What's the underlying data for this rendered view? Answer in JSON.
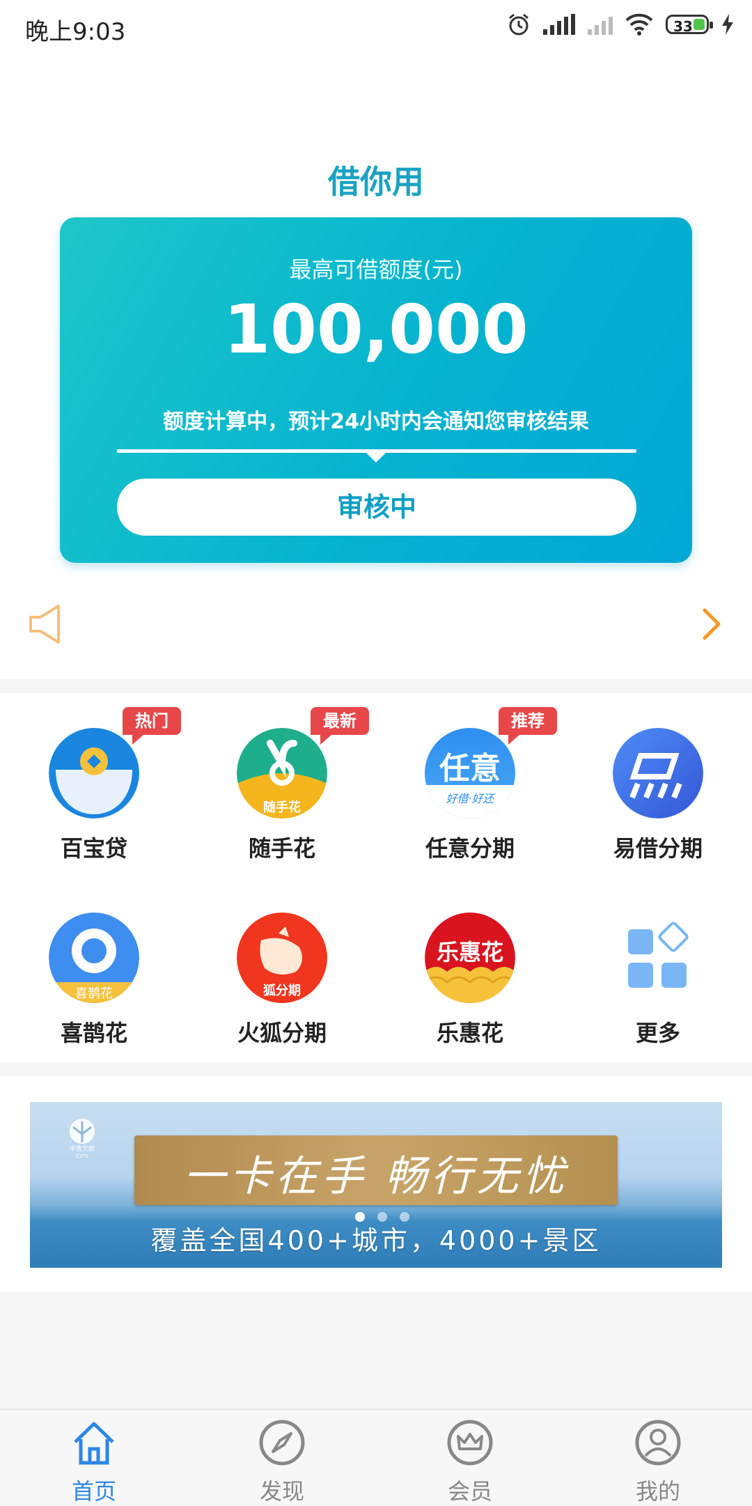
{
  "status_bar": {
    "time": "晚上9:03",
    "battery": "33"
  },
  "header": {
    "title": "借你用"
  },
  "card": {
    "label": "最高可借额度(元)",
    "amount": "100,000",
    "notice": "额度计算中，预计24小时内会通知您审核结果",
    "button": "审核中"
  },
  "grid": {
    "items": [
      {
        "label": "百宝贷",
        "badge": "热门",
        "icon": "coin-icon"
      },
      {
        "label": "随手花",
        "badge": "最新",
        "icon": "suishouhua-icon",
        "icon_text": "随手花"
      },
      {
        "label": "任意分期",
        "badge": "推荐",
        "icon": "renyi-icon",
        "icon_text": "任意",
        "icon_sub": "好借·好还"
      },
      {
        "label": "易借分期",
        "badge": "",
        "icon": "yijie-icon"
      },
      {
        "label": "喜鹊花",
        "badge": "",
        "icon": "magpie-icon",
        "icon_text": "喜鹊花"
      },
      {
        "label": "火狐分期",
        "badge": "",
        "icon": "fox-icon",
        "icon_text": "狐分期"
      },
      {
        "label": "乐惠花",
        "badge": "",
        "icon": "lehuihua-icon",
        "icon_text": "乐惠花"
      },
      {
        "label": "更多",
        "badge": "",
        "icon": "more-grid-icon"
      }
    ]
  },
  "banner": {
    "headline": "一卡在手  畅行无忧",
    "subtitle": "覆盖全国400+城市，4000+景区",
    "logo_text": "中青文旅",
    "logo_sub": "CYTS"
  },
  "tabbar": {
    "tabs": [
      {
        "label": "首页",
        "active": true
      },
      {
        "label": "发现",
        "active": false
      },
      {
        "label": "会员",
        "active": false
      },
      {
        "label": "我的",
        "active": false
      }
    ]
  },
  "colors": {
    "accent": "#1aa3c3",
    "tab_active": "#2c87e6",
    "badge": "#e8474a",
    "notice_icon": "#f5a623"
  }
}
